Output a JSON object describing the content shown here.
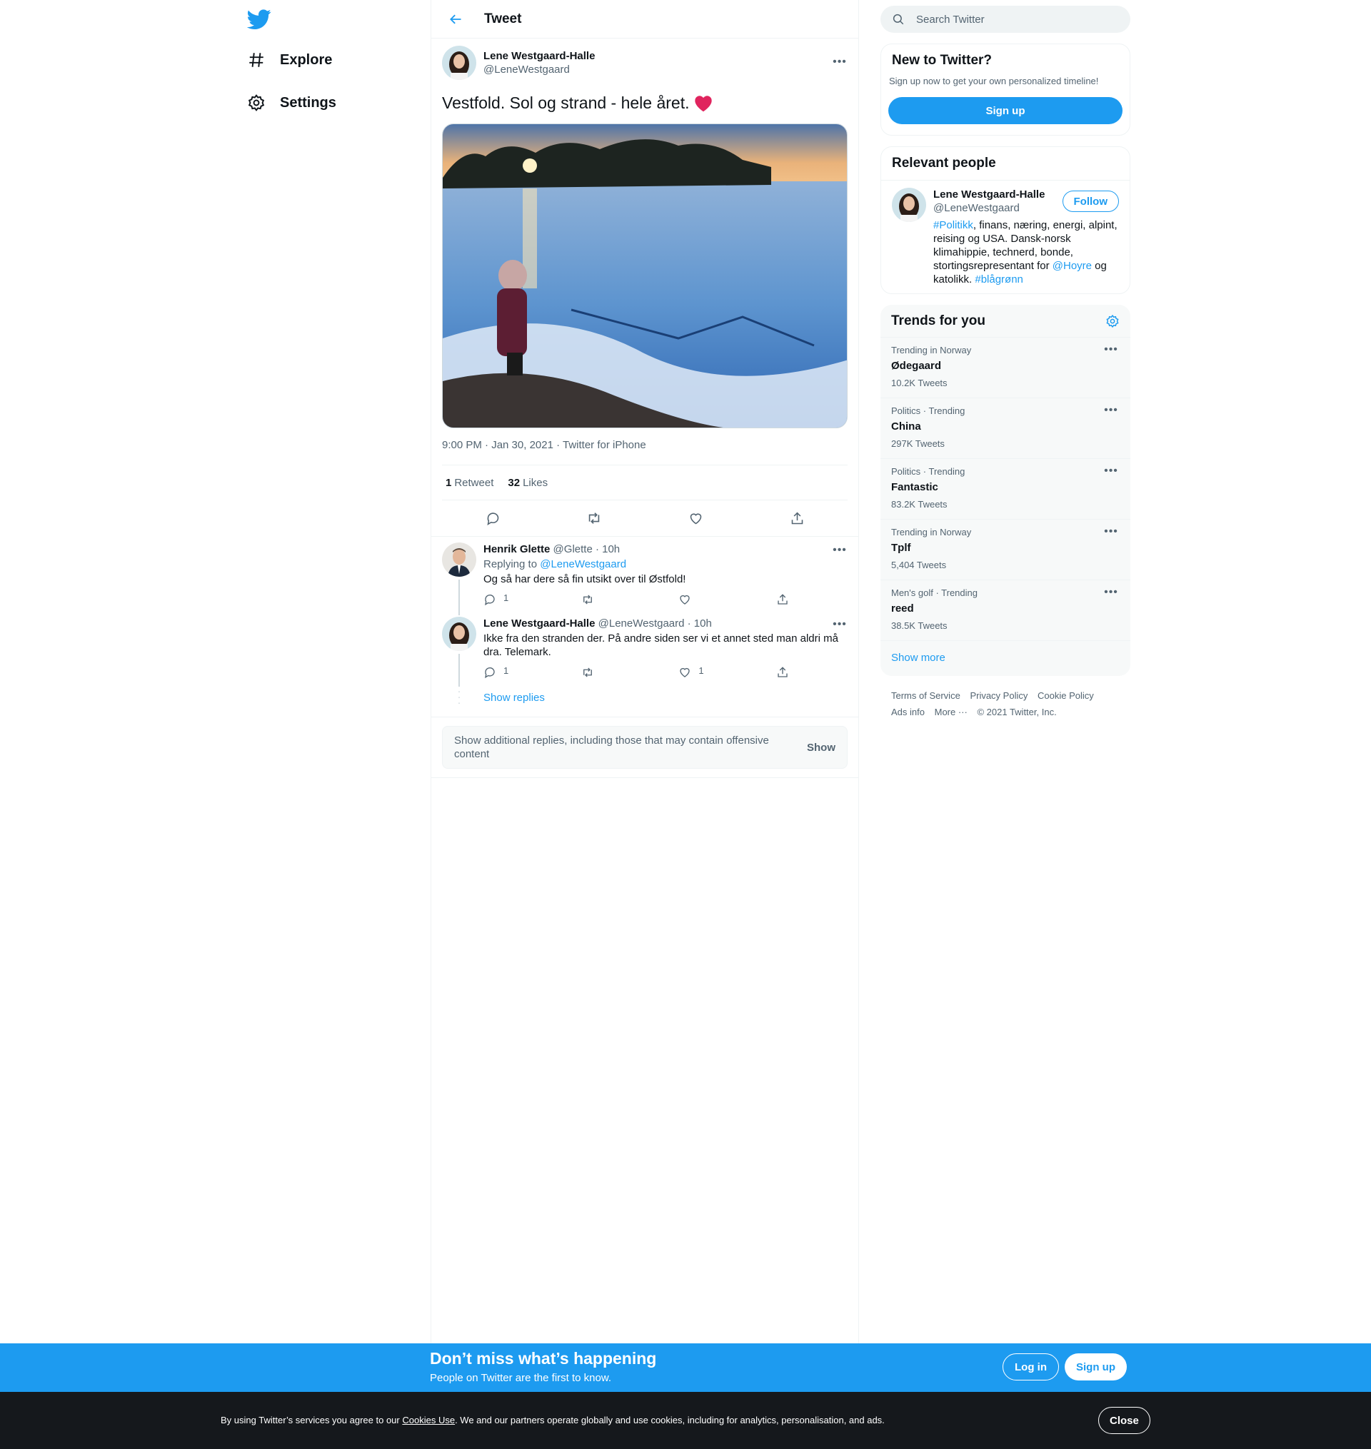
{
  "nav": {
    "items": [
      {
        "label": "Explore",
        "icon": "hashtag-icon"
      },
      {
        "label": "Settings",
        "icon": "gear-icon"
      }
    ]
  },
  "header": {
    "title": "Tweet"
  },
  "tweet": {
    "display_name": "Lene Westgaard-Halle",
    "handle": "@LeneWestgaard",
    "text": "Vestfold. Sol og strand - hele året.",
    "emoji": "❤️",
    "meta": "9:00 PM · Jan 30, 2021 · Twitter for iPhone",
    "retweets_count": "1",
    "retweets_label": "Retweet",
    "likes_count": "32",
    "likes_label": "Likes"
  },
  "replies": [
    {
      "display_name": "Henrik Glette",
      "handle_time": "@Glette · 10h",
      "replying_prefix": "Replying to",
      "replying_handle": "@LeneWestgaard",
      "text": "Og så har dere så fin utsikt over til Østfold!",
      "reply_count": "1",
      "retweet_count": "",
      "like_count": ""
    },
    {
      "display_name": "Lene Westgaard-Halle",
      "handle_time": "@LeneWestgaard · 10h",
      "text": "Ikke fra den stranden der. På andre siden ser vi et annet sted man aldri må dra. Telemark.",
      "reply_count": "1",
      "retweet_count": "",
      "like_count": "1"
    }
  ],
  "show_replies": "Show replies",
  "extra_replies": {
    "text": "Show additional replies, including those that may contain offensive content",
    "button": "Show"
  },
  "search": {
    "placeholder": "Search Twitter"
  },
  "new_to_twitter": {
    "title": "New to Twitter?",
    "subtitle": "Sign up now to get your own personalized timeline!",
    "button": "Sign up"
  },
  "relevant_people": {
    "title": "Relevant people",
    "person": {
      "display_name": "Lene Westgaard-Halle",
      "handle": "@LeneWestgaard",
      "follow": "Follow",
      "bio_1": "#Politikk",
      "bio_2": ", finans, næring, energi, alpint, reising og USA. Dansk-norsk klimahippie, technerd, bonde, stortingsrepresentant for ",
      "bio_3": "@Hoyre",
      "bio_4": " og katolikk. ",
      "bio_5": "#blågrønn"
    }
  },
  "trends": {
    "title": "Trends for you",
    "items": [
      {
        "context": "Trending in Norway",
        "name": "Ødegaard",
        "count": "10.2K Tweets"
      },
      {
        "context": "Politics · Trending",
        "name": "China",
        "count": "297K Tweets"
      },
      {
        "context": "Politics · Trending",
        "name": "Fantastic",
        "count": "83.2K Tweets"
      },
      {
        "context": "Trending in Norway",
        "name": "Tplf",
        "count": "5,404 Tweets"
      },
      {
        "context": "Men's golf · Trending",
        "name": "reed",
        "count": "38.5K Tweets"
      }
    ],
    "show_more": "Show more"
  },
  "footer": {
    "links": [
      "Terms of Service",
      "Privacy Policy",
      "Cookie Policy",
      "Ads info",
      "More ···",
      "© 2021 Twitter, Inc."
    ]
  },
  "banner": {
    "title": "Don’t miss what’s happening",
    "subtitle": "People on Twitter are the first to know.",
    "login": "Log in",
    "signup": "Sign up"
  },
  "cookies": {
    "pre": "By using Twitter’s services you agree to our ",
    "link": "Cookies Use",
    "post": ". We and our partners operate globally and use cookies, including for analytics, personalisation, and ads.",
    "close": "Close"
  },
  "colors": {
    "accent": "#1d9bf0",
    "heart": "#e0245e"
  }
}
